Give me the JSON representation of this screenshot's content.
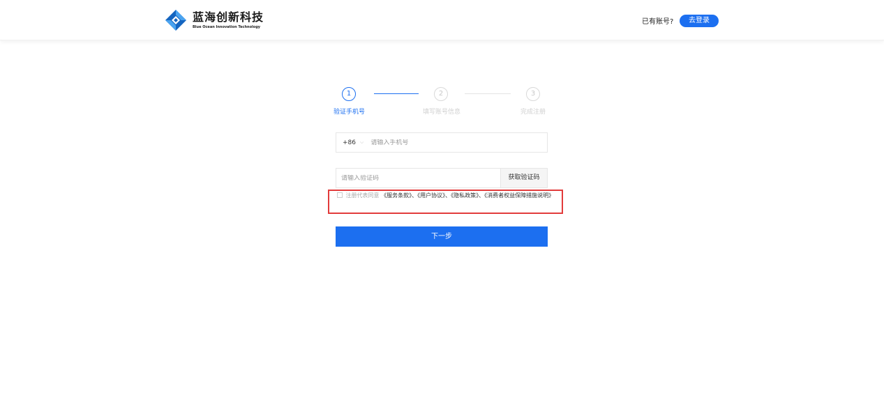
{
  "header": {
    "logo_cn": "蓝海创新科技",
    "logo_en": "Blue Ocean Innovation Technology",
    "has_account": "已有账号?",
    "login_label": "去登录"
  },
  "steps": [
    {
      "number": "1",
      "label": "验证手机号",
      "active": true
    },
    {
      "number": "2",
      "label": "填写账号信息",
      "active": false
    },
    {
      "number": "3",
      "label": "完成注册",
      "active": false
    }
  ],
  "form": {
    "country_code": "+86",
    "phone_placeholder": "请输入手机号",
    "code_placeholder": "请输入验证码",
    "get_code_label": "获取验证码",
    "agree_prefix": "注册代表同意",
    "agree_terms": "《服务条款》、《用户协议》、《隐私政策》、《消费者权益保障措施说明》",
    "next_label": "下一步"
  },
  "colors": {
    "accent": "#1c6ff0",
    "highlight": "#e23b3b"
  }
}
